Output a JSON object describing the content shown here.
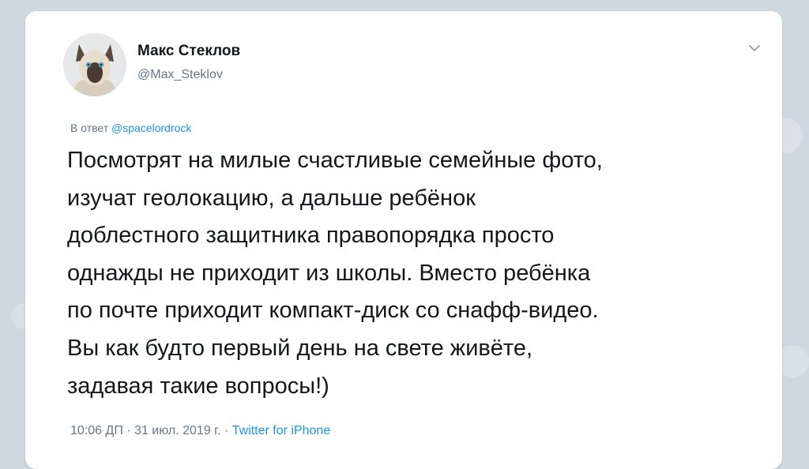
{
  "author": {
    "name": "Макс Стеклов",
    "handle": "@Max_Steklov",
    "avatar_icon": "cat-avatar-icon"
  },
  "menu_icon": "chevron-down-icon",
  "reply": {
    "prefix": "В ответ",
    "mention": "@spacelordrock"
  },
  "tweet": {
    "text": "Посмотрят на милые счастливые семейные фото,\nизучат геолокацию, а дальше ребёнок\nдоблестного защитника правопорядка просто\nоднажды не приходит из школы. Вместо ребёнка\nпо почте приходит компакт-диск со снафф-видео.\nВы как будто первый день на свете живёте,\nзадавая такие вопросы!)"
  },
  "meta": {
    "time": "10:06 ДП",
    "separator": "·",
    "date": "31 июл. 2019 г.",
    "source": "Twitter for iPhone"
  },
  "colors": {
    "link": "#1b95e0",
    "secondary_text": "#657786",
    "primary_text": "#14171a",
    "background": "#cfd8e1"
  }
}
